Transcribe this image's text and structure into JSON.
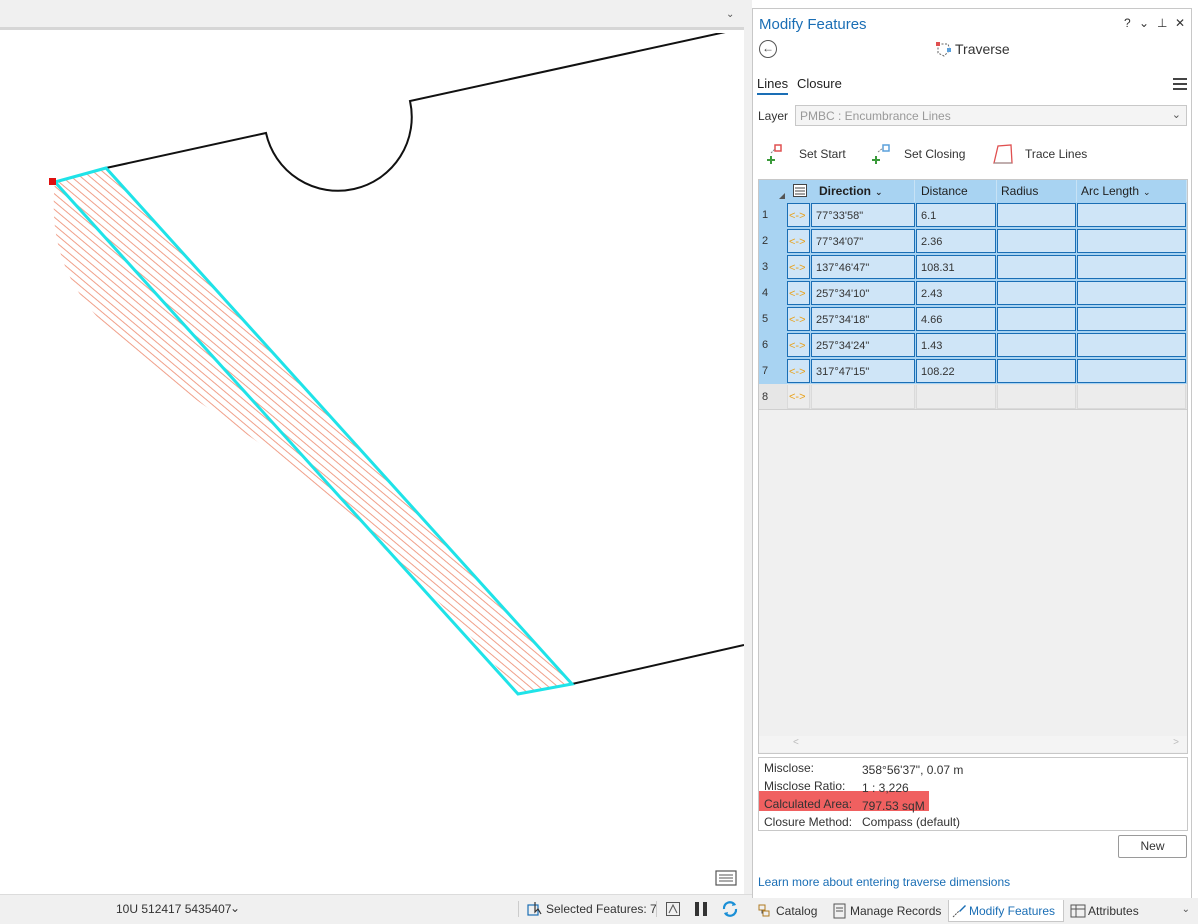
{
  "pane": {
    "title": "Modify Features",
    "controls": {
      "help": "?",
      "options": "⌄",
      "pin": "⊥",
      "close": "✕"
    },
    "tool_title": "Traverse",
    "tabs": [
      {
        "label": "Lines",
        "active": true
      },
      {
        "label": "Closure",
        "active": false
      }
    ],
    "layer_label": "Layer",
    "layer_value": "PMBC : Encumbrance Lines",
    "tool_buttons": [
      {
        "label": "Set Start",
        "icon": "set-start-icon"
      },
      {
        "label": "Set Closing",
        "icon": "set-closing-icon"
      },
      {
        "label": "Trace Lines",
        "icon": "trace-lines-icon"
      }
    ]
  },
  "grid": {
    "columns": [
      "Direction",
      "Distance",
      "Radius",
      "Arc Length"
    ],
    "rows": [
      {
        "num": "1",
        "direction": "77°33'58\"",
        "distance": "6.1",
        "radius": "",
        "arc_length": ""
      },
      {
        "num": "2",
        "direction": "77°34'07\"",
        "distance": "2.36",
        "radius": "",
        "arc_length": ""
      },
      {
        "num": "3",
        "direction": "137°46'47\"",
        "distance": "108.31",
        "radius": "",
        "arc_length": ""
      },
      {
        "num": "4",
        "direction": "257°34'10\"",
        "distance": "2.43",
        "radius": "",
        "arc_length": ""
      },
      {
        "num": "5",
        "direction": "257°34'18\"",
        "distance": "4.66",
        "radius": "",
        "arc_length": ""
      },
      {
        "num": "6",
        "direction": "257°34'24\"",
        "distance": "1.43",
        "radius": "",
        "arc_length": ""
      },
      {
        "num": "7",
        "direction": "317°47'15\"",
        "distance": "108.22",
        "radius": "",
        "arc_length": ""
      }
    ],
    "new_row_num": "8",
    "swap_icon": "<->"
  },
  "closure": {
    "misclose_label": "Misclose:",
    "misclose_value": "358°56'37\", 0.07 m",
    "ratio_label": "Misclose Ratio:",
    "ratio_value": "1 : 3,226",
    "area_label": "Calculated Area:",
    "area_value": "797.53 sqM",
    "method_label": "Closure Method:",
    "method_value": "Compass (default)"
  },
  "new_button": "New",
  "learn_link": "Learn more about entering traverse dimensions",
  "dock_tabs": [
    {
      "label": "Catalog",
      "active": false
    },
    {
      "label": "Manage Records",
      "active": false
    },
    {
      "label": "Modify Features",
      "active": true
    },
    {
      "label": "Attributes",
      "active": false
    }
  ],
  "status": {
    "coordinates": "10U 512417 5435407",
    "selected_features": "Selected Features: 7"
  },
  "colors": {
    "accent": "#1a6eb5",
    "selection_outline": "#1fe3e8",
    "hatch": "#f0a08a",
    "area_highlight": "#f06060",
    "start_point": "#e01010"
  }
}
